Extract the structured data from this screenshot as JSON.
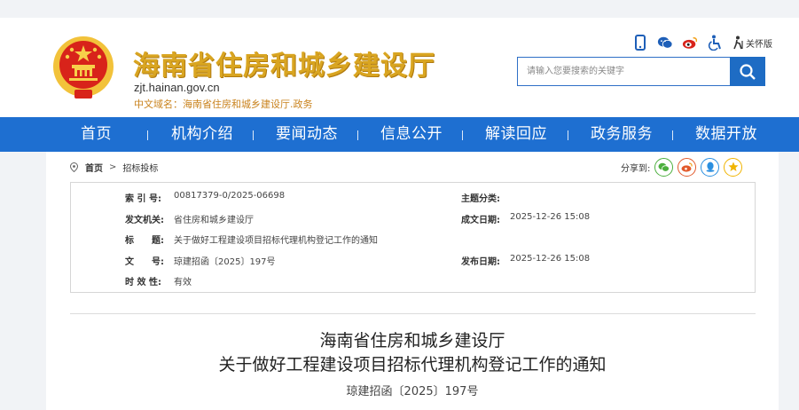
{
  "header": {
    "site_title": "海南省住房和城乡建设厅",
    "domain": "zjt.hainan.gov.cn",
    "cn_domain": "中文域名：海南省住房和城乡建设厅.政务",
    "care_mode": "关怀版",
    "icons": [
      "mobile-icon",
      "wechat-icon",
      "weibo-icon",
      "accessibility-icon",
      "elderly-care-icon"
    ]
  },
  "search": {
    "placeholder": "请输入您要搜索的关键字",
    "button_icon": "search-icon"
  },
  "nav": {
    "items": [
      "首页",
      "机构介绍",
      "要闻动态",
      "信息公开",
      "解读回应",
      "政务服务",
      "数据开放"
    ]
  },
  "breadcrumb": {
    "home": "首页",
    "sep": ">",
    "current": "招标投标"
  },
  "share": {
    "label": "分享到:",
    "icons": [
      "wechat-icon",
      "weibo-icon",
      "qq-icon",
      "qzone-icon"
    ]
  },
  "meta": {
    "index_label": "索 引 号:",
    "index_value": "00817379-0/2025-06698",
    "topic_label": "主题分类:",
    "topic_value": "",
    "issuer_label": "发文机关:",
    "issuer_value": "省住房和城乡建设厅",
    "created_label": "成文日期:",
    "created_value": "2025-12-26 15:08",
    "title_label": "标　　题:",
    "title_value": "关于做好工程建设项目招标代理机构登记工作的通知",
    "docno_label": "文　　号:",
    "docno_value": "琼建招函〔2025〕197号",
    "published_label": "发布日期:",
    "published_value": "2025-12-26 15:08",
    "validity_label": "时 效 性:",
    "validity_value": "有效"
  },
  "document": {
    "title_line1": "海南省住房和城乡建设厅",
    "title_line2": "关于做好工程建设项目招标代理机构登记工作的通知",
    "doc_number": "琼建招函〔2025〕197号"
  },
  "colors": {
    "nav_blue": "#1e6fd1",
    "title_gold": "#d9a521",
    "emblem_red": "#d8231a",
    "emblem_gold": "#f2c23a"
  }
}
